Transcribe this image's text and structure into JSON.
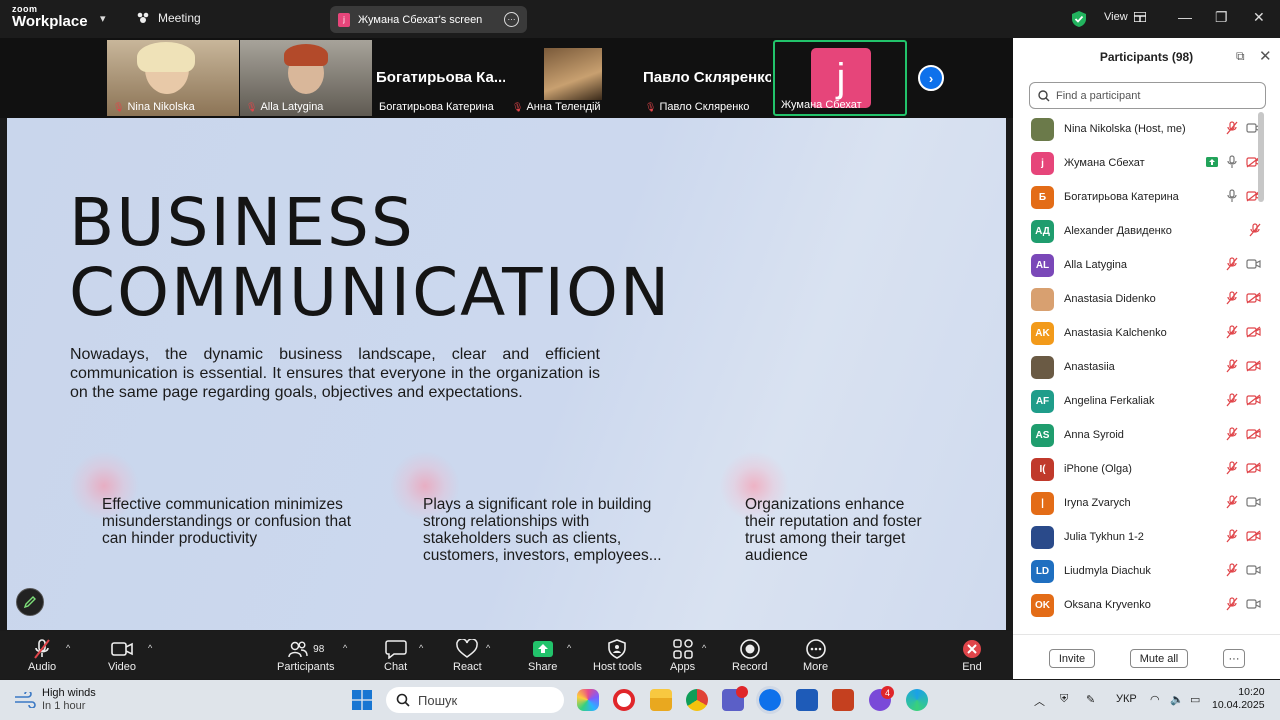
{
  "topbar": {
    "logo_line1": "zoom",
    "logo_line2": "Workplace",
    "meeting_label": "Meeting",
    "share_label": "Жумана Сбехат's screen",
    "view_label": "View"
  },
  "gallery": {
    "tiles": [
      {
        "name": "Nina Nikolska"
      },
      {
        "name": "Alla Latygina"
      },
      {
        "big_name": "Богатирьова Ка...",
        "name": "Богатирьова Катерина"
      },
      {
        "name": "Анна Телендій"
      },
      {
        "big_name": "Павло Скляренко...",
        "name": "Павло Скляренко"
      },
      {
        "avatar_letter": "j",
        "name": "Жумана Сбехат"
      }
    ]
  },
  "slide": {
    "title_line1": "BUSINESS",
    "title_line2": "COMMUNICATION",
    "lead": "Nowadays, the dynamic business landscape, clear and efficient communication is essential. It ensures that everyone in the organization is on the same page regarding goals, objectives and expectations.",
    "points": [
      "Effective communication minimizes misunderstandings or confusion that can hinder productivity",
      "Plays a significant role in building strong relationships with stakeholders such as clients, customers, investors, employees...",
      "Organizations enhance their reputation and foster trust among their target audience"
    ]
  },
  "toolbar": {
    "audio": "Audio",
    "video": "Video",
    "participants": "Participants",
    "participants_count": "98",
    "chat": "Chat",
    "react": "React",
    "share": "Share",
    "host_tools": "Host tools",
    "apps": "Apps",
    "record": "Record",
    "more": "More",
    "end": "End"
  },
  "panel": {
    "title": "Participants (98)",
    "search_placeholder": "Find a participant",
    "participants": [
      {
        "name": "Nina Nikolska (Host, me)",
        "initials": "",
        "color": "#6b7a4a",
        "mic": "muted",
        "video": "on"
      },
      {
        "name": "Жумана Сбехат",
        "initials": "j",
        "color": "#e6457a",
        "mic": "on",
        "video": "off",
        "sharing": true
      },
      {
        "name": "Богатирьова Катерина",
        "initials": "Б",
        "color": "#e36c17",
        "mic": "on",
        "video": "off"
      },
      {
        "name": "Alexander Давиденко",
        "initials": "АД",
        "color": "#1f9d6e",
        "mic": "none",
        "video": "muted_only"
      },
      {
        "name": "Alla Latygina",
        "initials": "AL",
        "color": "#7a48b8",
        "mic": "muted",
        "video": "on"
      },
      {
        "name": "Anastasia Didenko",
        "initials": "",
        "color": "#d8a070",
        "mic": "muted",
        "video": "off"
      },
      {
        "name": "Anastasia Kalchenko",
        "initials": "AK",
        "color": "#f29a1a",
        "mic": "muted",
        "video": "off"
      },
      {
        "name": "Anastasiia",
        "initials": "",
        "color": "#6a5a44",
        "mic": "muted",
        "video": "off"
      },
      {
        "name": "Angelina Ferkaliak",
        "initials": "AF",
        "color": "#1f9d8a",
        "mic": "muted",
        "video": "off"
      },
      {
        "name": "Anna Syroid",
        "initials": "AS",
        "color": "#1f9d6e",
        "mic": "muted",
        "video": "off"
      },
      {
        "name": "iPhone (Olga)",
        "initials": "I(",
        "color": "#c0392b",
        "mic": "muted",
        "video": "off"
      },
      {
        "name": "Iryna Zvarych",
        "initials": "|",
        "color": "#e36c17",
        "mic": "muted",
        "video": "on"
      },
      {
        "name": "Julia Tykhun 1-2",
        "initials": "",
        "color": "#2a4a8a",
        "mic": "muted",
        "video": "off"
      },
      {
        "name": "Liudmyla Diachuk",
        "initials": "LD",
        "color": "#1f6fc0",
        "mic": "muted",
        "video": "on"
      },
      {
        "name": "Oksana Kryvenko",
        "initials": "OK",
        "color": "#e36c17",
        "mic": "muted",
        "video": "on"
      }
    ],
    "invite": "Invite",
    "mute_all": "Mute all",
    "more": "···"
  },
  "taskbar": {
    "weather_title": "High winds",
    "weather_sub": "In 1 hour",
    "search_placeholder": "Пошук",
    "notification_badge": "4",
    "lang": "УКР",
    "time": "10:20",
    "date": "10.04.2025"
  }
}
